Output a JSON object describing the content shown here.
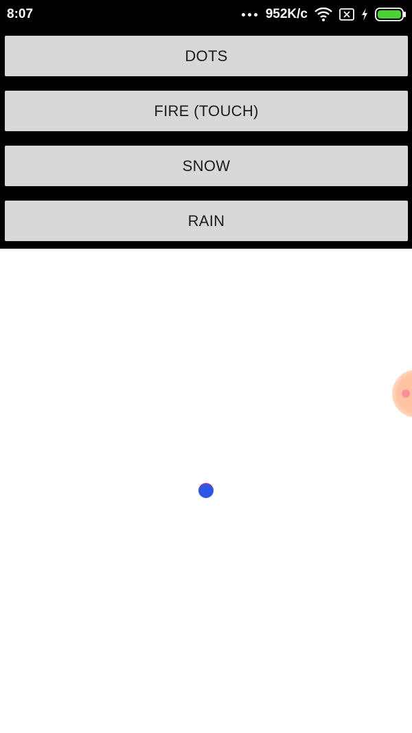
{
  "status_bar": {
    "time": "8:07",
    "network_speed": "952K/c",
    "icons": [
      "more-dots-icon",
      "wifi-icon",
      "no-sim-icon",
      "charging-bolt-icon",
      "battery-icon"
    ],
    "battery_color": "#4cd137"
  },
  "buttons": {
    "dots": "DOTS",
    "fire": "FIRE (TOUCH)",
    "snow": "SNOW",
    "rain": "RAIN"
  },
  "canvas": {
    "particles": [
      {
        "name": "blue-dot",
        "color": "#2f55e6"
      },
      {
        "name": "orange-particle",
        "color": "#ffc3a2"
      }
    ]
  }
}
